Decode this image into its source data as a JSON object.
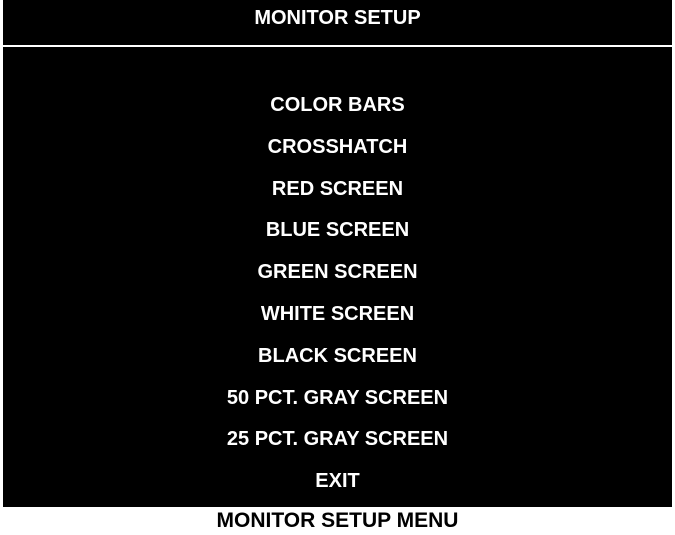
{
  "screen": {
    "title": "MONITOR SETUP",
    "menu_items": [
      {
        "label": "COLOR BARS"
      },
      {
        "label": "CROSSHATCH"
      },
      {
        "label": "RED SCREEN"
      },
      {
        "label": "BLUE SCREEN"
      },
      {
        "label": "GREEN SCREEN"
      },
      {
        "label": "WHITE SCREEN"
      },
      {
        "label": "BLACK SCREEN"
      },
      {
        "label": "50 PCT. GRAY SCREEN"
      },
      {
        "label": "25 PCT. GRAY SCREEN"
      },
      {
        "label": "EXIT"
      }
    ]
  },
  "caption": "MONITOR SETUP MENU",
  "colors": {
    "screen_background": "#000000",
    "screen_text": "#ffffff",
    "page_background": "#ffffff",
    "caption_text": "#000000"
  }
}
